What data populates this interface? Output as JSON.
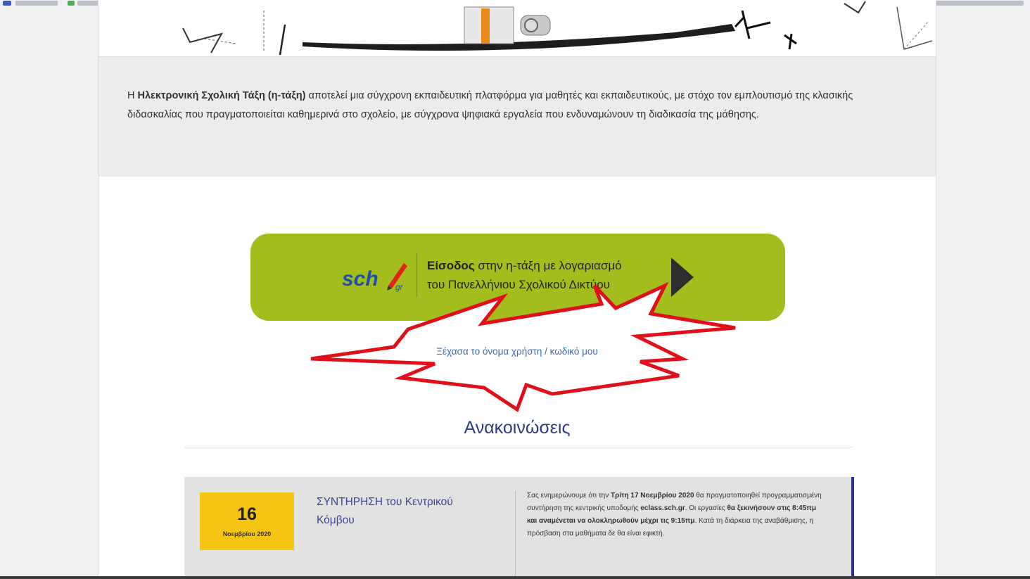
{
  "intro": {
    "prefix": "Η ",
    "bold": "Ηλεκτρονική Σχολική Τάξη (η-τάξη)",
    "rest": " αποτελεί μια σύγχρονη εκπαιδευτική πλατφόρμα για μαθητές και εκπαιδευτικούς, με στόχο τον εμπλουτισμό της κλασικής διδασκαλίας που πραγματοποιείται καθημερινά στο σχολείο, με σύγχρονα ψηφιακά εργαλεία που ενδυναμώνουν τη διαδικασία της μάθησης."
  },
  "login": {
    "logo_text": "sch",
    "logo_sub": "gr",
    "bold": "Είσοδος",
    "line1_rest": " στην η-τάξη με λογαριασμό",
    "line2": "του Πανελλήνιου Σχολικού Δικτύου",
    "bg_color": "#a3bd1c"
  },
  "forgot_link": "Ξέχασα το όνομα χρήστη / κωδικό μου",
  "starburst_color": "#e0101a",
  "announcements": {
    "title": "Ανακοινώσεις",
    "items": [
      {
        "day": "16",
        "month": "Νοεμβρίου 2020",
        "title": "ΣΥΝΤΗΡΗΣΗ του Κεντρικού Κόμβου",
        "body_1": "Σας ενημερώνουμε ότι την ",
        "body_b1": "Τρίτη 17 Νοεμβρίου 2020",
        "body_2": " θα πραγματοποιηθεί προγραμματισμένη συντήρηση της κεντρικής υποδομής ",
        "body_b2": "eclass.sch.gr",
        "body_3": ". Οι εργασίες ",
        "body_b3": "θα ξεκινήσουν στις 8:45πμ και αναμένεται να ολοκληρωθούν μέχρι τις 9:15πμ",
        "body_4": ". Κατά τη διάρκεια της αναβάθμισης, η πρόσβαση στα μαθήματα δε θα είναι εφικτή."
      }
    ]
  }
}
